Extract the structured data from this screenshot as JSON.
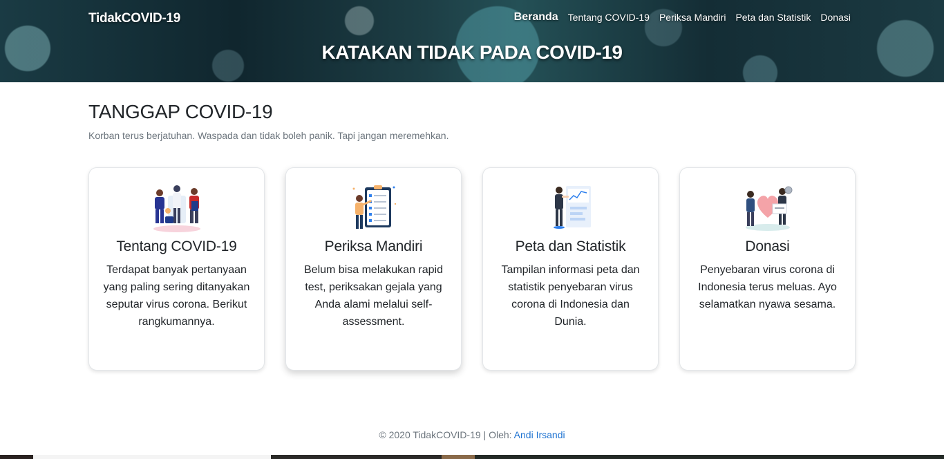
{
  "header": {
    "brand": "TidakCOVID-19",
    "nav": [
      {
        "label": "Beranda",
        "active": true
      },
      {
        "label": "Tentang COVID-19",
        "active": false
      },
      {
        "label": "Periksa Mandiri",
        "active": false
      },
      {
        "label": "Peta dan Statistik",
        "active": false
      },
      {
        "label": "Donasi",
        "active": false
      }
    ],
    "hero_title": "KATAKAN TIDAK PADA COVID-19"
  },
  "main": {
    "title": "TANGGAP COVID-19",
    "subtitle": "Korban terus berjatuhan. Waspada dan tidak boleh panik. Tapi jangan meremehkan.",
    "cards": [
      {
        "title": "Tentang COVID-19",
        "text": "Terdapat banyak pertanyaan yang paling sering ditanyakan seputar virus corona. Berikut rangkumannya.",
        "icon": "people-discussion-illustration"
      },
      {
        "title": "Periksa Mandiri",
        "text": "Belum bisa melakukan rapid test, periksakan gejala yang Anda alami melalui self-assessment.",
        "icon": "checklist-illustration"
      },
      {
        "title": "Peta dan Statistik",
        "text": "Tampilan informasi peta dan statistik penyebaran virus corona di Indonesia dan Dunia.",
        "icon": "statistics-board-illustration"
      },
      {
        "title": "Donasi",
        "text": "Penyebaran virus corona di Indonesia terus meluas. Ayo selamatkan nyawa sesama.",
        "icon": "donation-heart-illustration"
      }
    ]
  },
  "footer": {
    "copyright": "© 2020 TidakCOVID-19 | Oleh: ",
    "author": "Andi Irsandi"
  },
  "colors": {
    "link": "#1f73d1",
    "muted": "#6c757d",
    "hero_bg": "#1b3a42"
  }
}
